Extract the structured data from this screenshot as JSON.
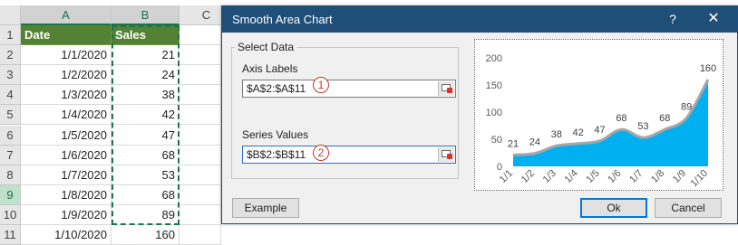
{
  "spreadsheet": {
    "columns": [
      "A",
      "B",
      "C"
    ],
    "rows": [
      {
        "num": "1",
        "a": "Date",
        "b": "Sales"
      },
      {
        "num": "2",
        "a": "1/1/2020",
        "b": "21"
      },
      {
        "num": "3",
        "a": "1/2/2020",
        "b": "24"
      },
      {
        "num": "4",
        "a": "1/3/2020",
        "b": "38"
      },
      {
        "num": "5",
        "a": "1/4/2020",
        "b": "42"
      },
      {
        "num": "6",
        "a": "1/5/2020",
        "b": "47"
      },
      {
        "num": "7",
        "a": "1/6/2020",
        "b": "68"
      },
      {
        "num": "8",
        "a": "1/7/2020",
        "b": "53"
      },
      {
        "num": "9",
        "a": "1/8/2020",
        "b": "68"
      },
      {
        "num": "10",
        "a": "1/9/2020",
        "b": "89"
      },
      {
        "num": "11",
        "a": "1/10/2020",
        "b": "160"
      }
    ],
    "header_fill": "#548235",
    "selection_color": "#217346"
  },
  "dialog": {
    "title": "Smooth Area Chart",
    "help_glyph": "?",
    "close_glyph": "✕",
    "group_label": "Select Data",
    "axis_labels": {
      "label": "Axis Labels",
      "value": "$A$2:$A$11",
      "badge": "1"
    },
    "series_values": {
      "label": "Series Values",
      "value": "$B$2:$B$11",
      "badge": "2"
    },
    "buttons": {
      "example": "Example",
      "ok": "Ok",
      "cancel": "Cancel"
    },
    "title_bar_color": "#1f4e79",
    "ref_button_icon": "range-select-icon"
  },
  "chart_data": {
    "type": "area",
    "smooth": true,
    "categories": [
      "1/1",
      "1/2",
      "1/3",
      "1/4",
      "1/5",
      "1/6",
      "1/7",
      "1/8",
      "1/9",
      "1/10"
    ],
    "values": [
      21,
      24,
      38,
      42,
      47,
      68,
      53,
      68,
      89,
      160
    ],
    "ylim": [
      0,
      200
    ],
    "yticks": [
      "0",
      "50",
      "100",
      "150",
      "200"
    ],
    "data_labels": true,
    "grid": false,
    "fill_color": "#00b0f0",
    "title": "",
    "xlabel": "",
    "ylabel": ""
  }
}
